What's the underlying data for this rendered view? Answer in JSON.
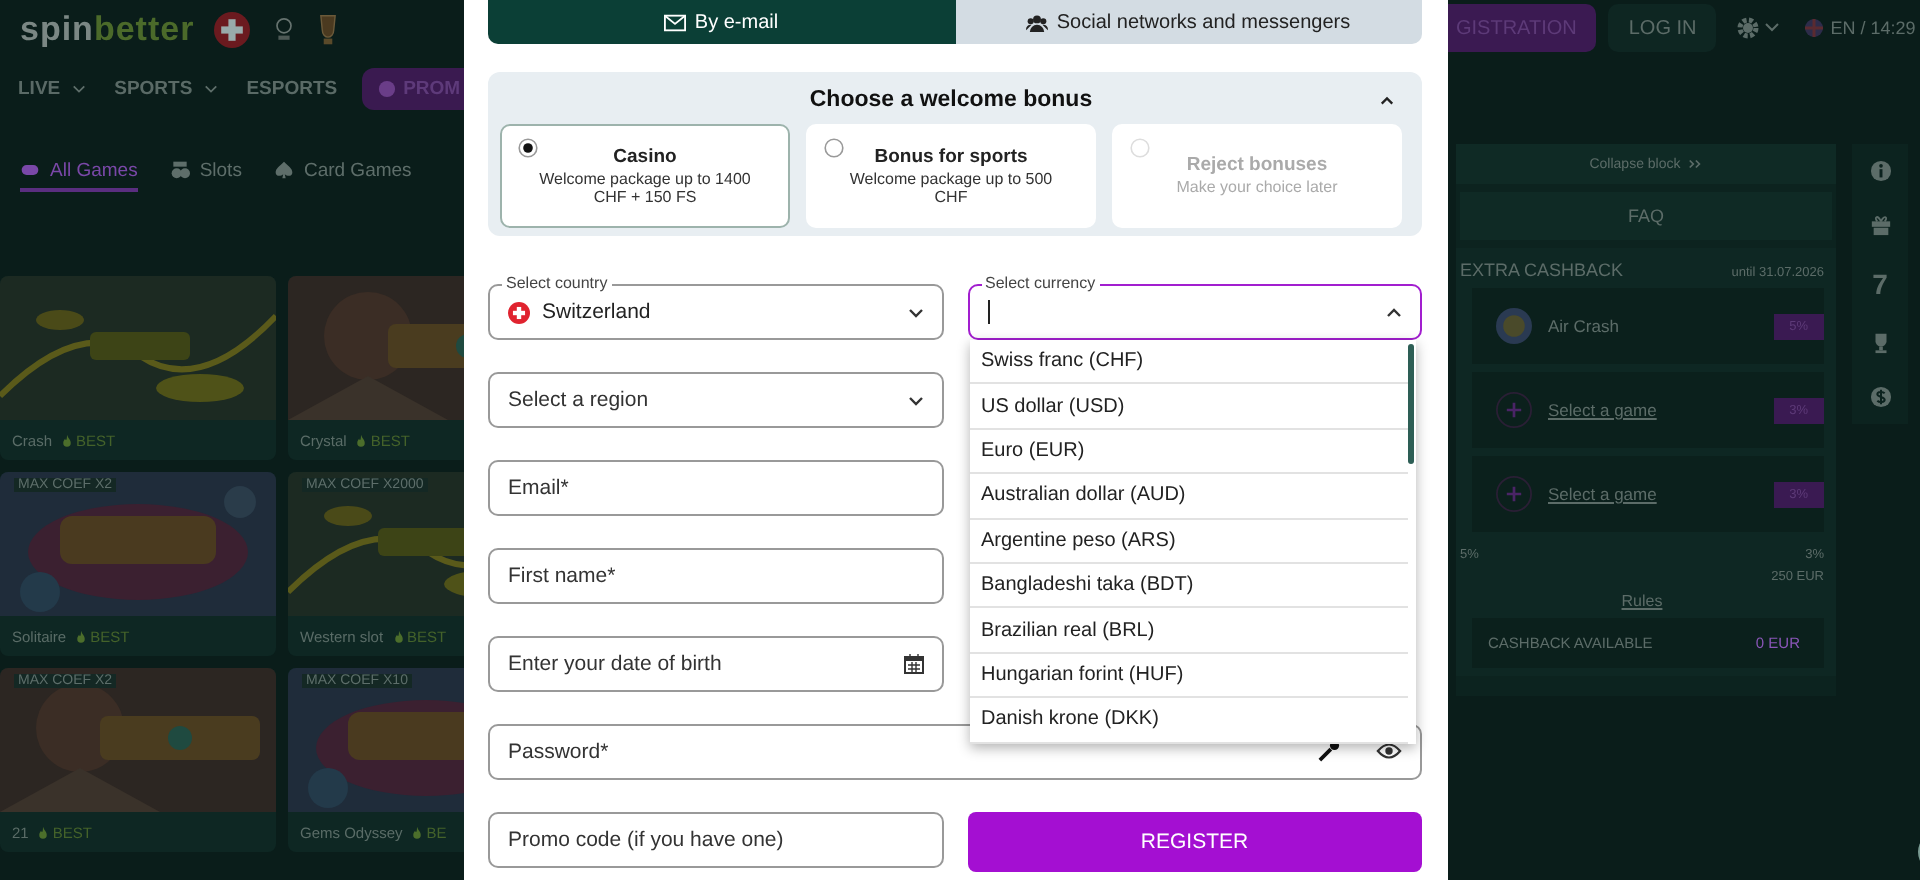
{
  "header": {
    "logo_left": "spin",
    "logo_right": "better",
    "nav": [
      {
        "label": "LIVE",
        "has_menu": true
      },
      {
        "label": "SPORTS",
        "has_menu": true
      },
      {
        "label": "ESPORTS",
        "has_menu": false
      }
    ],
    "promo": "PROM",
    "register": "GISTRATION",
    "login": "LOG IN",
    "locale": "EN / 14:29"
  },
  "game_tabs": [
    {
      "label": "All Games",
      "kind": "all",
      "selected": true
    },
    {
      "label": "Slots",
      "kind": "slots",
      "selected": false
    },
    {
      "label": "Card Games",
      "kind": "cards",
      "selected": false
    }
  ],
  "games": [
    {
      "title": "Crash",
      "badge": "BEST"
    },
    {
      "title": "Crystal",
      "badge": "BEST"
    },
    {
      "coef": "MAX COEF X2",
      "title": "Solitaire",
      "badge": "BEST"
    },
    {
      "coef": "MAX COEF X2000",
      "title": "Western slot",
      "badge": "BEST"
    },
    {
      "coef": "MAX COEF X2",
      "title": "21",
      "badge": "BEST"
    },
    {
      "coef": "MAX COEF X10",
      "title": "Gems Odyssey",
      "badge": "BE"
    }
  ],
  "modal": {
    "tabs": [
      {
        "label": "By e-mail",
        "kind": "email",
        "selected": true
      },
      {
        "label": "Social networks and messengers",
        "kind": "social",
        "selected": false
      }
    ],
    "bonus": {
      "title": "Choose a welcome bonus",
      "expanded": true,
      "options": [
        {
          "title": "Casino",
          "description": "Welcome package up to 1400 CHF + 150 FS",
          "selected": true,
          "disabled": false
        },
        {
          "title": "Bonus for sports",
          "description": "Welcome package up to 500 CHF",
          "selected": false,
          "disabled": false
        },
        {
          "title": "Reject bonuses",
          "description": "Make your choice later",
          "selected": false,
          "disabled": true
        }
      ]
    },
    "country": {
      "label": "Select country",
      "value": "Switzerland"
    },
    "currency": {
      "label": "Select currency",
      "open": true,
      "options": [
        "Swiss franc (CHF)",
        "US dollar (USD)",
        "Euro (EUR)",
        "Australian dollar (AUD)",
        "Argentine peso (ARS)",
        "Bangladeshi taka (BDT)",
        "Brazilian real (BRL)",
        "Hungarian forint (HUF)",
        "Danish krone (DKK)"
      ]
    },
    "region": {
      "placeholder": "Select a region"
    },
    "email": {
      "placeholder": "Email*"
    },
    "first_name": {
      "placeholder": "First name*"
    },
    "birth_date": {
      "placeholder": "Enter your date of birth"
    },
    "password": {
      "placeholder": "Password*"
    },
    "promo_code": {
      "placeholder": "Promo code (if you have one)"
    },
    "register": "REGISTER"
  },
  "cashback": {
    "collapse": "Collapse block",
    "faq": "FAQ",
    "title": "EXTRA CASHBACK",
    "until": "until 31.07.2026",
    "games": [
      {
        "kind": "game",
        "name": "Air Crash",
        "percent": "5%"
      },
      {
        "kind": "empty",
        "name": "Select a game",
        "percent": "3%"
      },
      {
        "kind": "empty",
        "name": "Select a game",
        "percent": "3%"
      }
    ],
    "range_min": "5%",
    "range_max": "3%",
    "limit": "250 EUR",
    "rules": "Rules",
    "available_label": "CASHBACK AVAILABLE",
    "available_value": "0 EUR"
  },
  "side_badge": "7"
}
